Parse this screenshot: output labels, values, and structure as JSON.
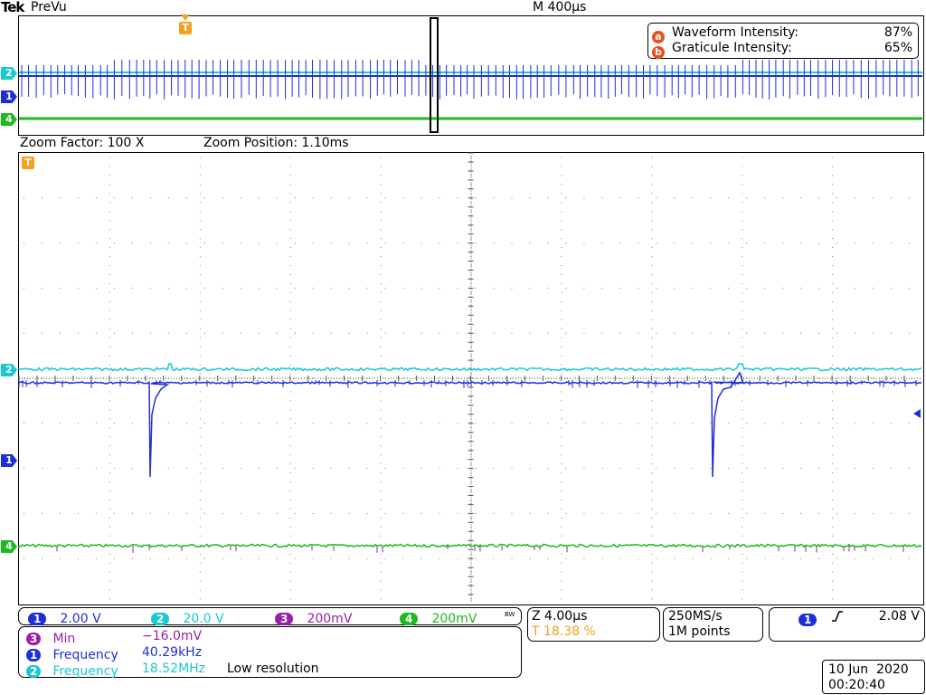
{
  "header": {
    "brand": "Tek",
    "mode": "PreVu",
    "timebase": "M 400µs"
  },
  "intensity": {
    "waveform_key": "a",
    "waveform_label": "Waveform Intensity:",
    "waveform_value": "87%",
    "graticule_key": "b",
    "graticule_label": "Graticule Intensity:",
    "graticule_value": "65%"
  },
  "zoom": {
    "factor": "Zoom Factor: 100 X",
    "position": "Zoom Position: 1.10ms"
  },
  "markers": {
    "trigger": "T",
    "ch1": "1",
    "ch2": "2",
    "ch3": "3",
    "ch4": "4"
  },
  "channels": [
    {
      "num": "1",
      "scale": "2.00 V",
      "color": "#1f2fd6"
    },
    {
      "num": "2",
      "scale": "20.0 V",
      "color": "#19c8d2"
    },
    {
      "num": "3",
      "scale": "200mV",
      "color": "#9a1fa8"
    },
    {
      "num": "4",
      "scale": "200mV",
      "color": "#1fb81f"
    }
  ],
  "bw_flag": "BW",
  "horizontal": {
    "zoom_scale": "Z 4.00µs",
    "trigger_pos": "T 18.38 %",
    "sample_rate": "250MS/s",
    "record_length": "1M points"
  },
  "trigger": {
    "source": "1",
    "slope_icon": "rising-edge-icon",
    "level": "2.08 V"
  },
  "measurements": [
    {
      "src": "3",
      "name": "Min",
      "value": "−16.0mV",
      "note": "",
      "color": "#9a1fa8"
    },
    {
      "src": "1",
      "name": "Frequency",
      "value": "40.29kHz",
      "note": "",
      "color": "#1f2fd6"
    },
    {
      "src": "2",
      "name": "Frequency",
      "value": "18.52MHz",
      "note": "Low resolution",
      "color": "#19c8d2"
    }
  ],
  "datetime": {
    "date": "10 Jun  2020",
    "time": "00:20:40"
  },
  "colors": {
    "ch1": "#1f2fd6",
    "ch2": "#19c8d2",
    "ch3": "#9a1fa8",
    "ch4": "#1fb81f",
    "trigger": "#f5a020",
    "intensity_key": "#e8501e"
  }
}
